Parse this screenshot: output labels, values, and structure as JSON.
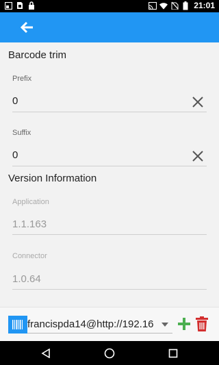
{
  "status_bar": {
    "time": "21:01",
    "left_icons": [
      "screen-share-icon",
      "sim-icon",
      "lock-icon"
    ],
    "right_icons": [
      "cast-icon",
      "wifi-icon",
      "no-sim-icon",
      "battery-icon"
    ]
  },
  "app_bar": {
    "back_icon": "arrow-left-icon",
    "color": "#2196f3"
  },
  "barcode_trim": {
    "title": "Barcode trim",
    "prefix": {
      "label": "Prefix",
      "value": "0"
    },
    "suffix": {
      "label": "Suffix",
      "value": "0"
    }
  },
  "version_info": {
    "title": "Version Information",
    "application": {
      "label": "Application",
      "value": "1.1.163"
    },
    "connector": {
      "label": "Connector",
      "value": "1.0.64"
    }
  },
  "connection": {
    "selected": "francispda14@http://192.16",
    "add_color": "#4caf50",
    "delete_color": "#d32f2f"
  },
  "nav_bar": {
    "buttons": [
      "back-triangle-icon",
      "home-circle-icon",
      "recents-square-icon"
    ]
  }
}
